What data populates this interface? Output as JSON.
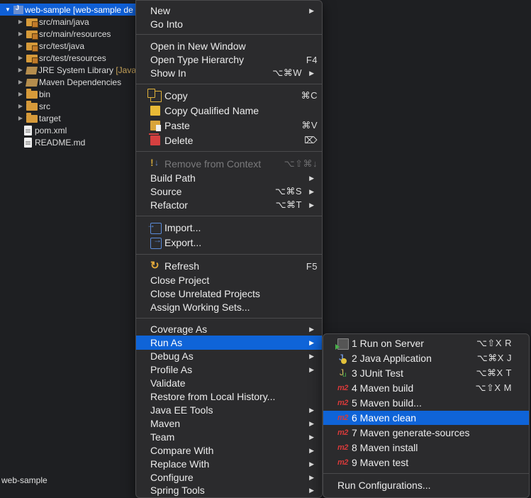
{
  "tree": {
    "project": "web-sample [web-sample de",
    "items": [
      {
        "label": "src/main/java",
        "icon": "package-folder-icon"
      },
      {
        "label": "src/main/resources",
        "icon": "package-folder-icon"
      },
      {
        "label": "src/test/java",
        "icon": "package-folder-icon"
      },
      {
        "label": "src/test/resources",
        "icon": "package-folder-icon"
      },
      {
        "label": "JRE System Library",
        "suffix": "[JavaS",
        "icon": "library-icon"
      },
      {
        "label": "Maven Dependencies",
        "icon": "library-icon"
      },
      {
        "label": "bin",
        "icon": "folder-icon"
      },
      {
        "label": "src",
        "icon": "folder-icon"
      },
      {
        "label": "target",
        "icon": "folder-icon"
      },
      {
        "label": "pom.xml",
        "icon": "file-icon"
      },
      {
        "label": "README.md",
        "icon": "file-icon"
      }
    ]
  },
  "status": {
    "text": "web-sample"
  },
  "menu": {
    "new": "New",
    "go_into": "Go Into",
    "open_new_window": "Open in New Window",
    "open_type_hierarchy": "Open Type Hierarchy",
    "open_type_hierarchy_sc": "F4",
    "show_in": "Show In",
    "show_in_sc": "⌥⌘W",
    "copy": "Copy",
    "copy_sc": "⌘C",
    "copy_qualified": "Copy Qualified Name",
    "paste": "Paste",
    "paste_sc": "⌘V",
    "delete": "Delete",
    "delete_sc": "⌦",
    "remove_context": "Remove from Context",
    "remove_context_sc": "⌥⇧⌘↓",
    "build_path": "Build Path",
    "source": "Source",
    "source_sc": "⌥⌘S",
    "refactor": "Refactor",
    "refactor_sc": "⌥⌘T",
    "import": "Import...",
    "export": "Export...",
    "refresh": "Refresh",
    "refresh_sc": "F5",
    "close_project": "Close Project",
    "close_unrelated": "Close Unrelated Projects",
    "assign_working_sets": "Assign Working Sets...",
    "coverage_as": "Coverage As",
    "run_as": "Run As",
    "debug_as": "Debug As",
    "profile_as": "Profile As",
    "validate": "Validate",
    "restore_history": "Restore from Local History...",
    "java_ee_tools": "Java EE Tools",
    "maven": "Maven",
    "team": "Team",
    "compare_with": "Compare With",
    "replace_with": "Replace With",
    "configure": "Configure",
    "spring_tools": "Spring Tools"
  },
  "submenu": {
    "m2_badge": "m2",
    "run_on_server": "1 Run on Server",
    "run_on_server_sc": "⌥⇧X R",
    "java_app": "2 Java Application",
    "java_app_sc": "⌥⌘X J",
    "junit": "3 JUnit Test",
    "junit_sc": "⌥⌘X T",
    "maven_build": "4 Maven build",
    "maven_build_sc": "⌥⇧X M",
    "maven_build_dots": "5 Maven build...",
    "maven_clean": "6 Maven clean",
    "maven_generate": "7 Maven generate-sources",
    "maven_install": "8 Maven install",
    "maven_test": "9 Maven test",
    "run_configurations": "Run Configurations..."
  },
  "colors": {
    "highlight": "#0f64d8",
    "menu_bg": "#2b2b2d",
    "tree_bg": "#1e1f22"
  }
}
